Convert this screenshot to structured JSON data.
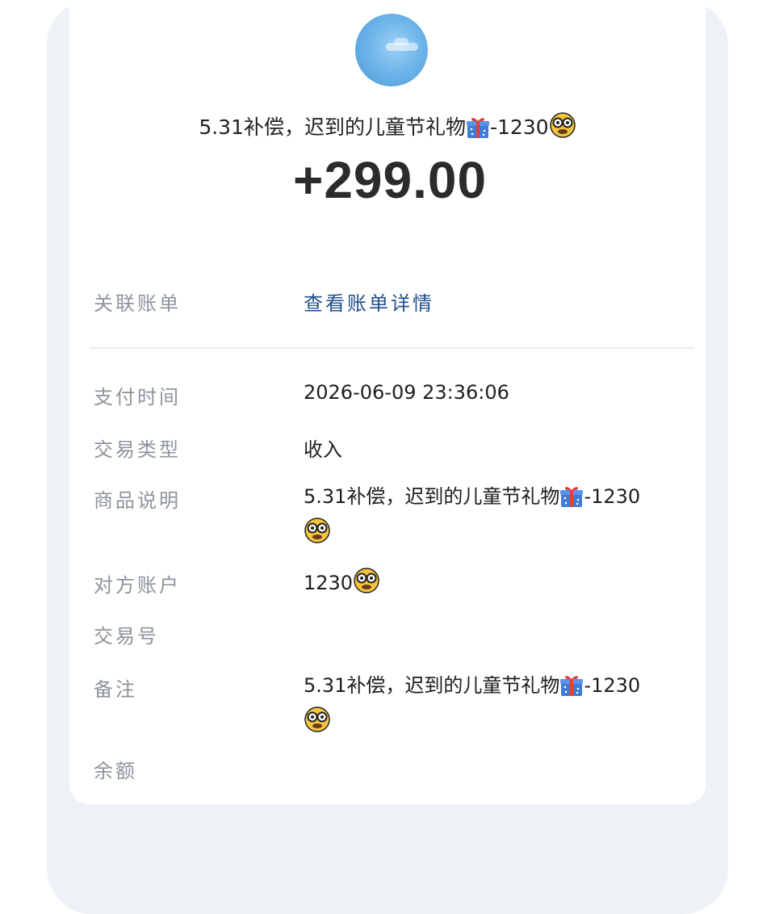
{
  "header": {
    "title_text": "5.31补偿，迟到的儿童节礼物",
    "title_suffix": "-1230",
    "amount": "+299.00",
    "gift_icon": "gift-icon",
    "face_icon": "nerd-face-icon"
  },
  "rows": {
    "linked_bill": {
      "label": "关联账单",
      "value": "查看账单详情"
    },
    "pay_time": {
      "label": "支付时间",
      "value": "2026-06-09  23:36:06"
    },
    "trade_type": {
      "label": "交易类型",
      "value": "收入"
    },
    "product_desc": {
      "label": "商品说明",
      "value_text": "5.31补偿，迟到的儿童节礼物",
      "value_suffix": "-1230"
    },
    "counterparty": {
      "label": "对方账户",
      "value": "1230"
    },
    "trade_no": {
      "label": "交易号",
      "value": ""
    },
    "remark": {
      "label": "备注",
      "value_text": "5.31补偿，迟到的儿童节礼物",
      "value_suffix": "-1230"
    },
    "balance": {
      "label": "余额",
      "value": ""
    }
  },
  "colors": {
    "link": "#1f4f8c",
    "label": "#8e949a",
    "background_panel": "#eef1f5"
  }
}
